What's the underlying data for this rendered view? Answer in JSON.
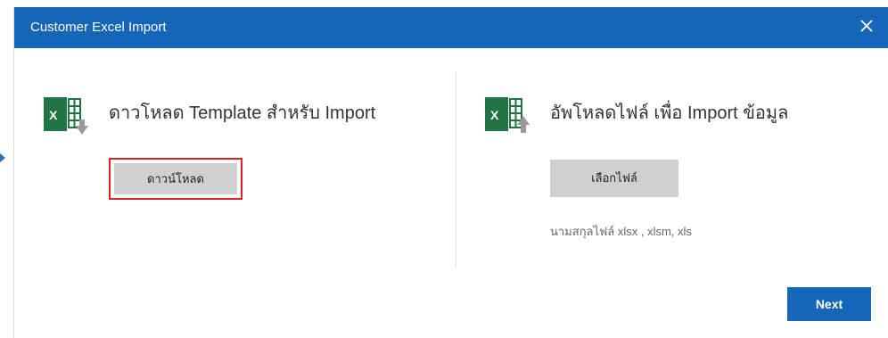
{
  "dialog": {
    "title": "Customer Excel Import",
    "close_icon": "close-icon"
  },
  "download_panel": {
    "icon": "excel-download-icon",
    "title": "ดาวโหลด Template สำหรับ Import",
    "button_label": "ดาวน์โหลด"
  },
  "upload_panel": {
    "icon": "excel-upload-icon",
    "title": "อัพโหลดไฟล์ เพื่อ Import ข้อมูล",
    "button_label": "เลือกไฟล์",
    "hint": "นามสกุลไฟล์ xlsx , xlsm, xls"
  },
  "footer": {
    "next_label": "Next"
  },
  "colors": {
    "header": "#1565b8",
    "button_gray": "#d0d0d0",
    "highlight_border": "#e02020",
    "excel_green": "#217346"
  }
}
